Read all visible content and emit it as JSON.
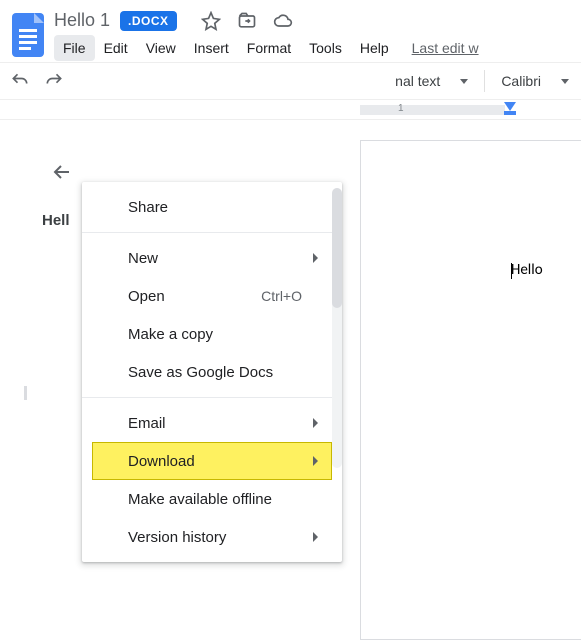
{
  "header": {
    "doc_title": "Hello 1",
    "badge": ".DOCX",
    "last_edit": "Last edit w"
  },
  "menubar": {
    "items": [
      "File",
      "Edit",
      "View",
      "Insert",
      "Format",
      "Tools",
      "Help"
    ],
    "open_index": 0
  },
  "toolbar": {
    "style_select": "nal text",
    "font_select": "Calibri"
  },
  "ruler": {
    "labels": [
      "1"
    ]
  },
  "outline": {
    "heading": "Hell"
  },
  "document": {
    "text": "Hello"
  },
  "file_menu": {
    "items": [
      {
        "label": "Share",
        "submenu": false
      },
      {
        "separator": true
      },
      {
        "label": "New",
        "submenu": true
      },
      {
        "label": "Open",
        "shortcut": "Ctrl+O"
      },
      {
        "label": "Make a copy"
      },
      {
        "label": "Save as Google Docs"
      },
      {
        "separator": true
      },
      {
        "label": "Email",
        "submenu": true
      },
      {
        "label": "Download",
        "submenu": true,
        "highlight": true
      },
      {
        "label": "Make available offline"
      },
      {
        "label": "Version history",
        "submenu": true
      }
    ]
  },
  "icons": {
    "star": "star-icon",
    "move": "move-to-folder-icon",
    "cloud": "cloud-status-icon",
    "undo": "undo-icon",
    "redo": "redo-icon",
    "back": "back-arrow-icon"
  }
}
